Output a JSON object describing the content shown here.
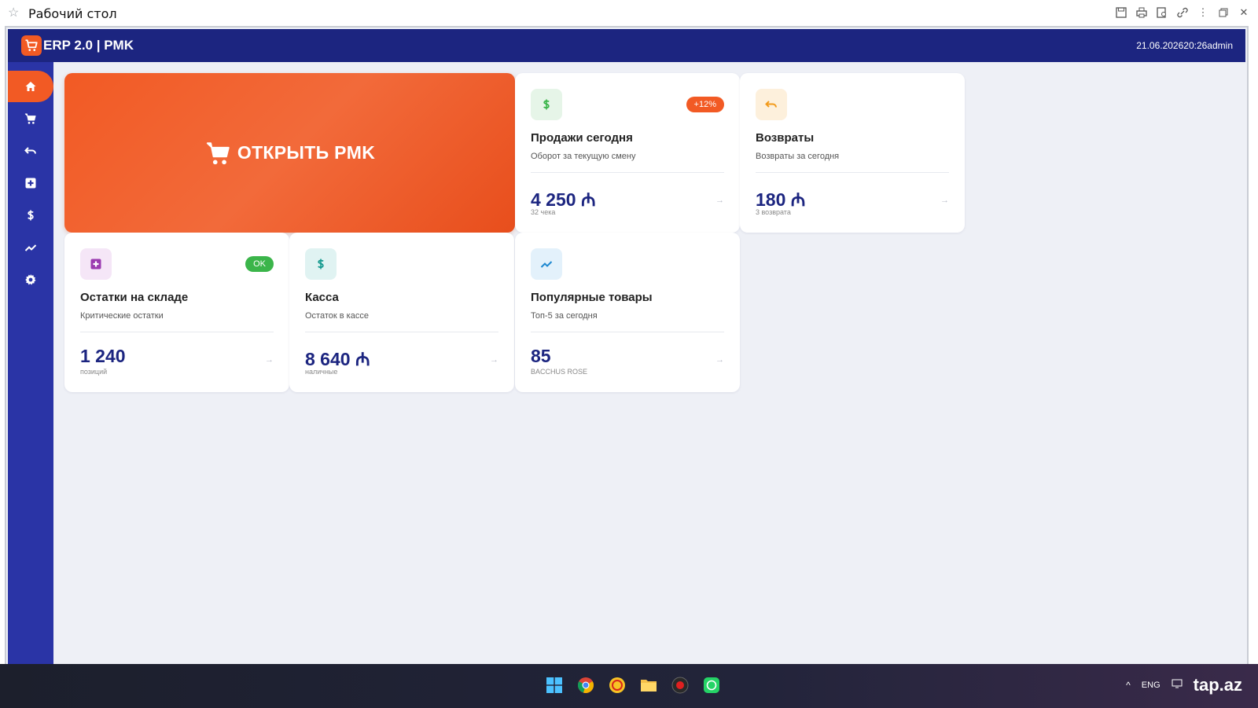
{
  "window": {
    "title": "Рабочий стол"
  },
  "app": {
    "title": "ERP 2.0 | PMK",
    "datetime_user": "21.06.202620:26admin"
  },
  "sidebar": {
    "items": [
      {
        "icon": "home-icon",
        "active": true
      },
      {
        "icon": "cart-icon",
        "active": false
      },
      {
        "icon": "undo-icon",
        "active": false
      },
      {
        "icon": "plus-square-icon",
        "active": false
      },
      {
        "icon": "dollar-icon",
        "active": false
      },
      {
        "icon": "trend-icon",
        "active": false
      },
      {
        "icon": "gear-icon",
        "active": false
      }
    ]
  },
  "hero": {
    "label": "ОТКРЫТЬ PMK"
  },
  "cards": {
    "sales": {
      "title": "Продажи сегодня",
      "subtitle": "Оборот за текущую смену",
      "value": "4 250 ₼",
      "caption": "32 чека",
      "badge": "+12%",
      "arrow": "→"
    },
    "returns": {
      "title": "Возвраты",
      "subtitle": "Возвраты за сегодня",
      "value": "180 ₼",
      "caption": "3 возврата",
      "arrow": "→"
    },
    "stock": {
      "title": "Остатки на складе",
      "subtitle": "Критические остатки",
      "value": "1 240",
      "caption": "позиций",
      "badge": "OK",
      "arrow": "→"
    },
    "cash": {
      "title": "Касса",
      "subtitle": "Остаток в кассе",
      "value": "8 640 ₼",
      "caption": "наличные",
      "arrow": "→"
    },
    "popular": {
      "title": "Популярные товары",
      "subtitle": "Топ-5 за сегодня",
      "value": "85",
      "caption": "BACCHUS ROSE",
      "arrow": "→"
    }
  },
  "colors": {
    "brand": "#1c2580",
    "sidebar": "#2a34a6",
    "accent": "#f25a24",
    "ok": "#3bb54a"
  },
  "taskbar": {
    "lang": "ENG",
    "watermark": "tap.az"
  }
}
